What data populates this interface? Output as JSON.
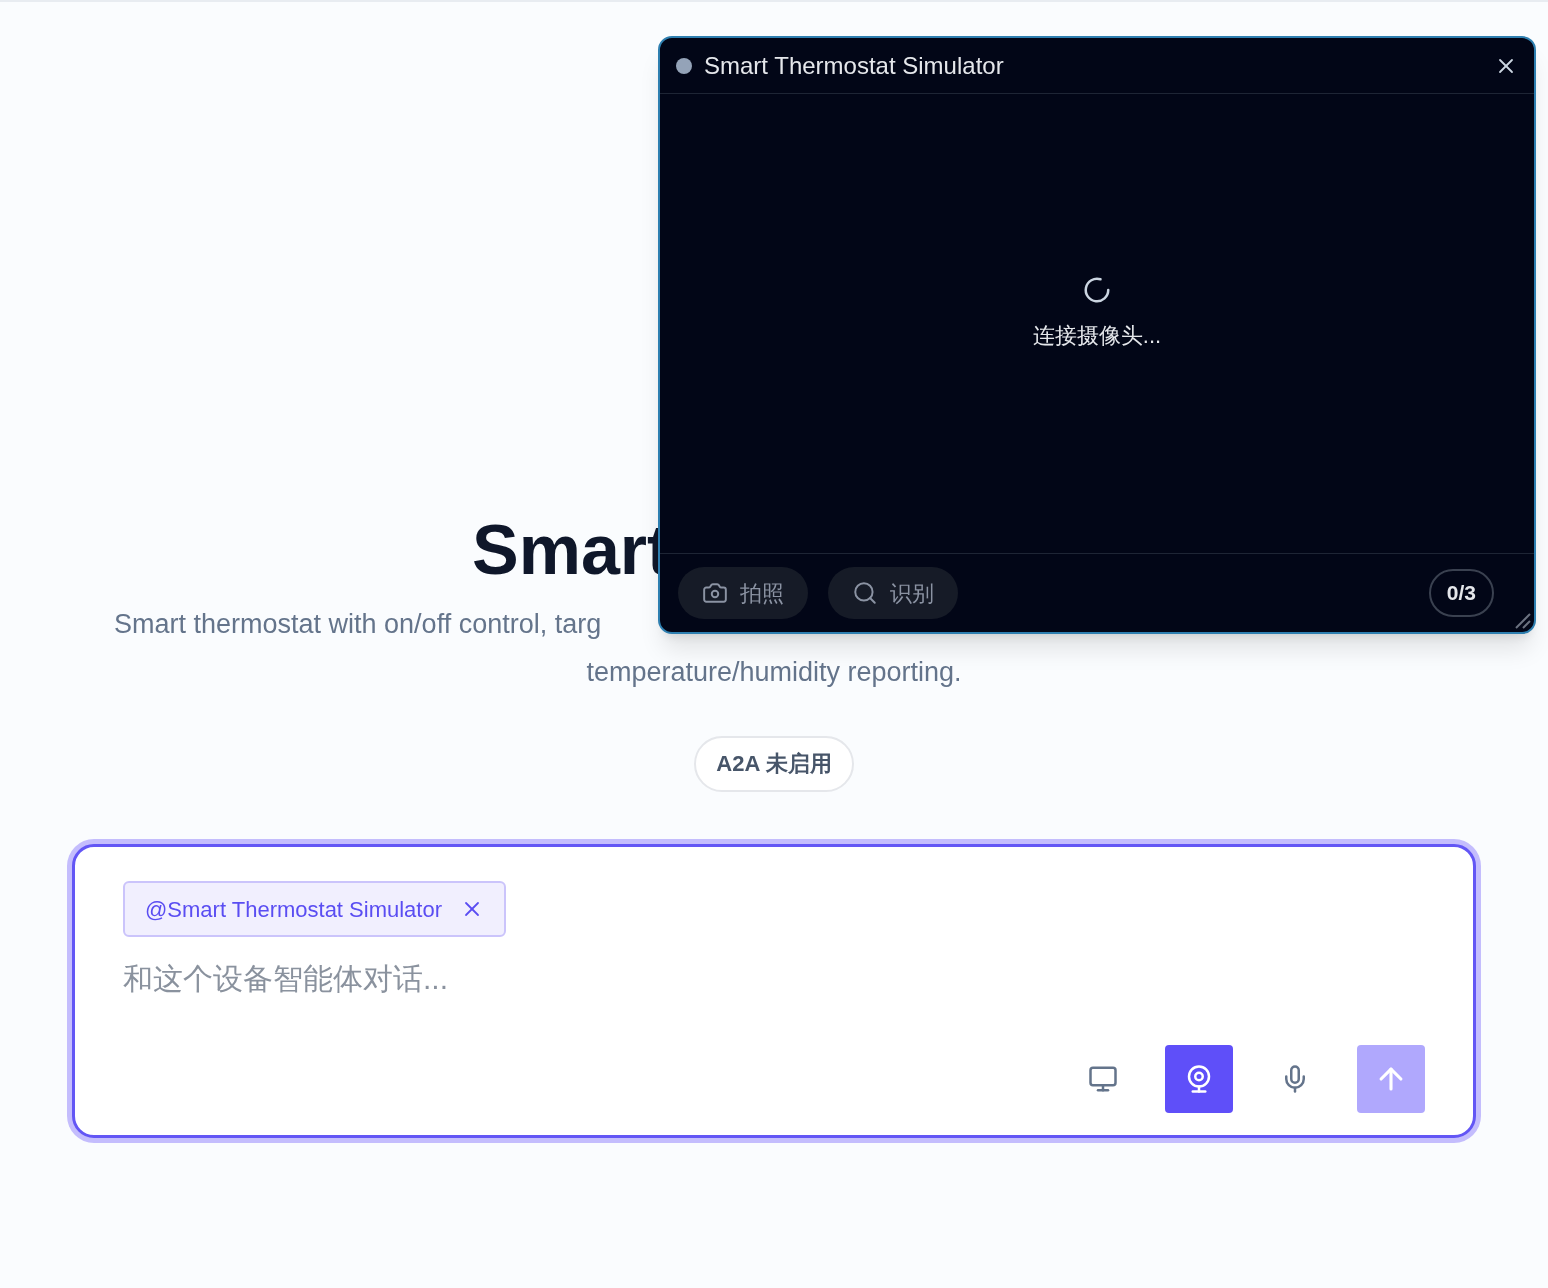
{
  "hero": {
    "title": "Smart",
    "description": [
      "Smart thermostat with on/off control, targ",
      "temperature/humidity reporting."
    ],
    "badge": "A2A 未启用"
  },
  "composer": {
    "mention": "@Smart Thermostat Simulator",
    "placeholder": "和这个设备智能体对话...",
    "tools": [
      {
        "kind": "screen",
        "selected": false
      },
      {
        "kind": "camera",
        "selected": true
      },
      {
        "kind": "mic",
        "selected": false
      }
    ],
    "send": {
      "disabled": true
    }
  },
  "camera_window": {
    "title": "Smart Thermostat Simulator",
    "status": "连接摄像头...",
    "actions": [
      {
        "kind": "photo",
        "label": "拍照"
      },
      {
        "kind": "recognize",
        "label": "识别"
      }
    ],
    "counter": "0/3"
  }
}
